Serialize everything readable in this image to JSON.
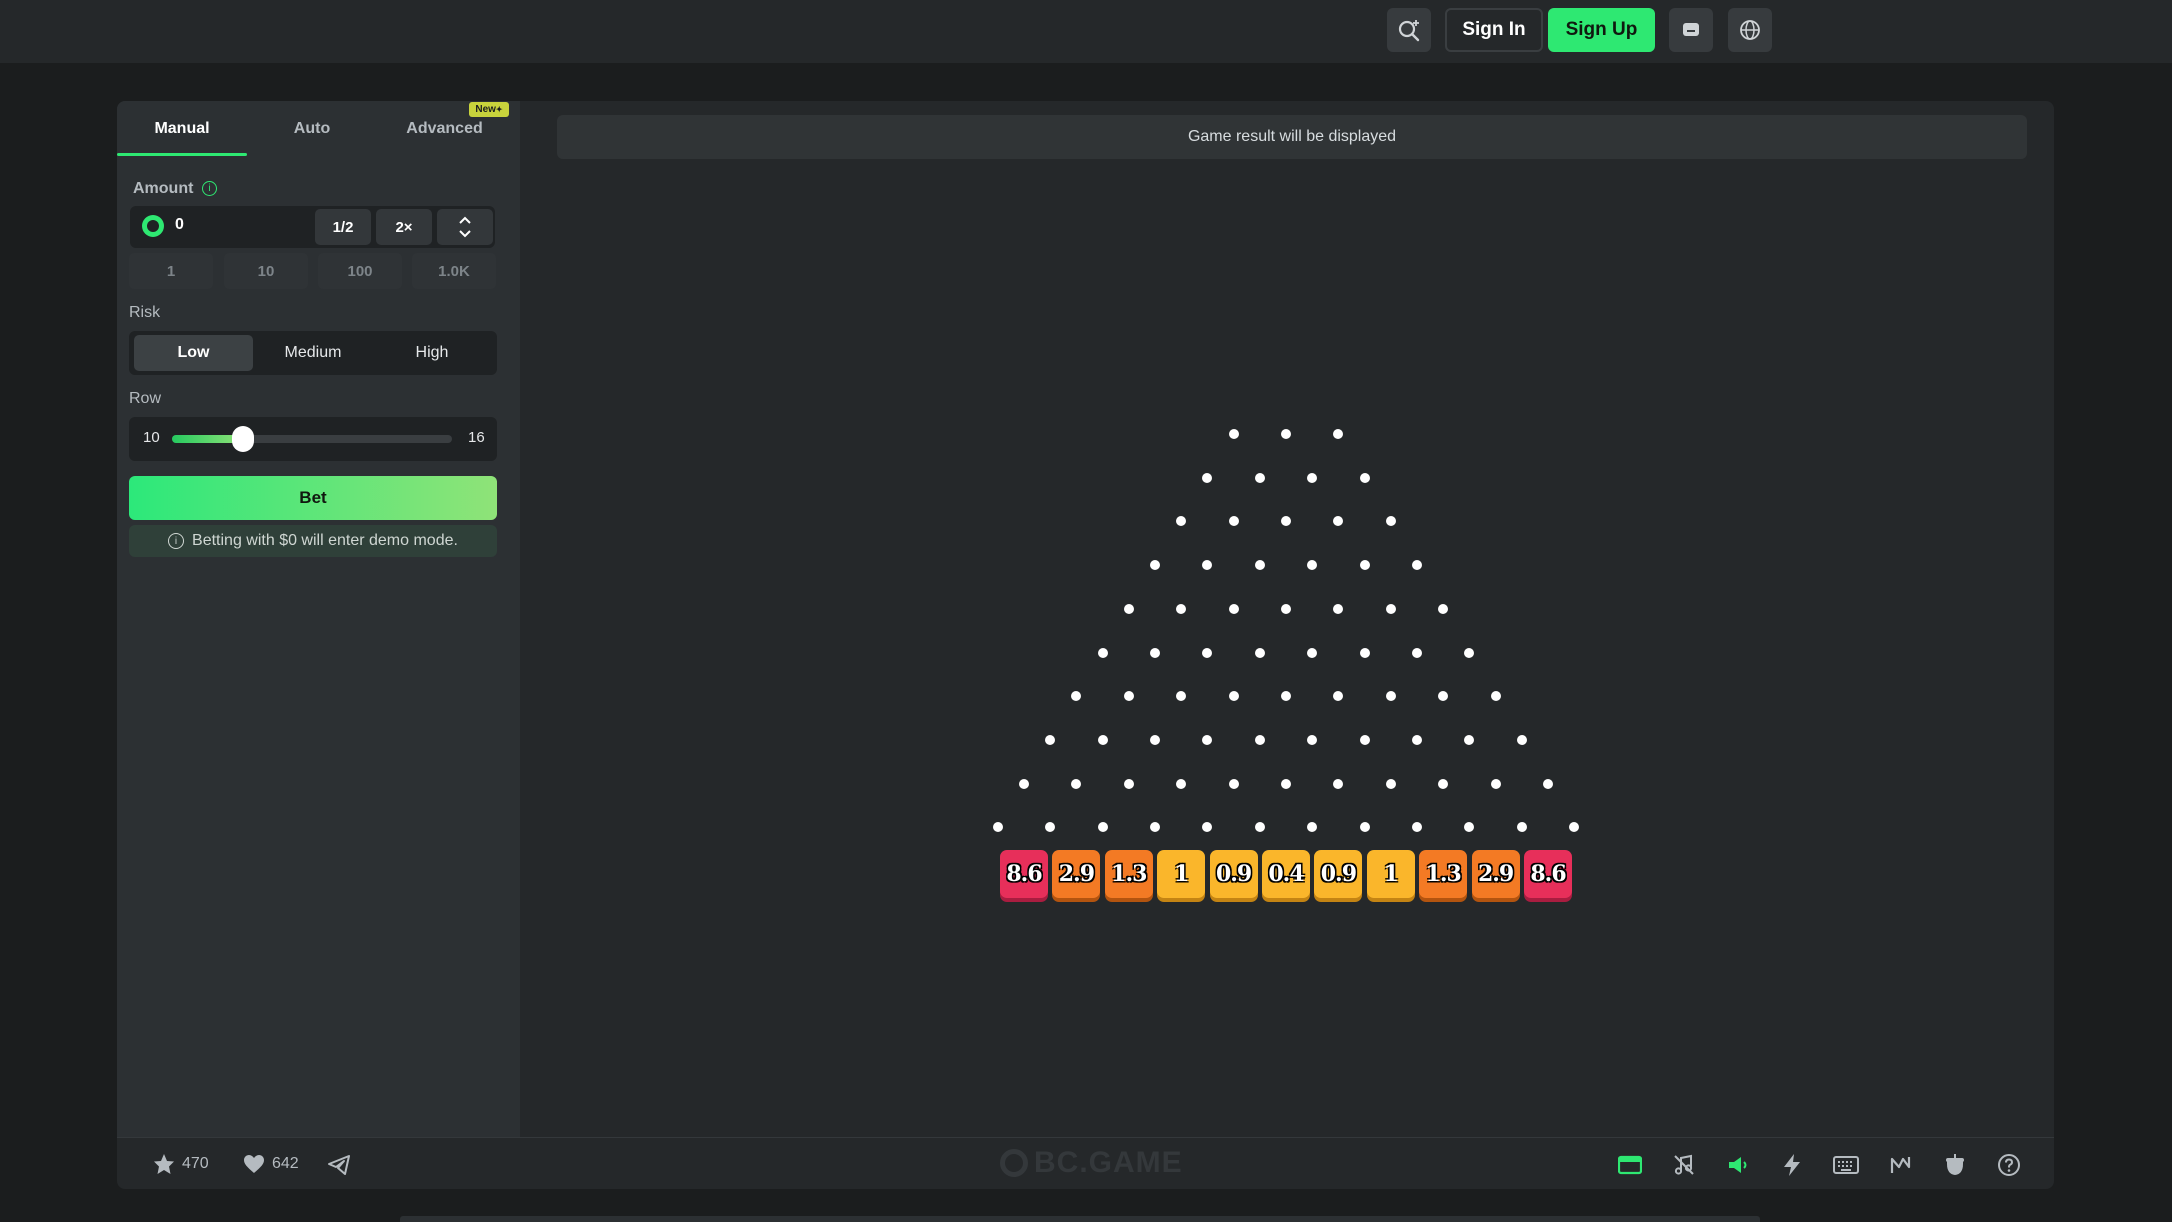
{
  "header": {
    "sign_in": "Sign In",
    "sign_up": "Sign Up"
  },
  "tabs": {
    "manual": "Manual",
    "auto": "Auto",
    "advanced": "Advanced",
    "new_badge": "New"
  },
  "amount": {
    "label": "Amount",
    "value": "0",
    "half": "1/2",
    "double": "2×",
    "chips": [
      "1",
      "10",
      "100",
      "1.0K"
    ]
  },
  "risk": {
    "label": "Risk",
    "options": [
      "Low",
      "Medium",
      "High"
    ],
    "selected": "Low"
  },
  "row": {
    "label": "Row",
    "min": "10",
    "max": "16",
    "value": 10
  },
  "bet": {
    "label": "Bet",
    "demo_note": "Betting with $0 will enter demo mode."
  },
  "result": {
    "text": "Game result will be displayed"
  },
  "multipliers": [
    {
      "label": "8.6",
      "color": "#e72f5a"
    },
    {
      "label": "2.9",
      "color": "#f37a24"
    },
    {
      "label": "1.3",
      "color": "#f37a24"
    },
    {
      "label": "1",
      "color": "#fab62b"
    },
    {
      "label": "0.9",
      "color": "#fab62b"
    },
    {
      "label": "0.4",
      "color": "#fab62b"
    },
    {
      "label": "0.9",
      "color": "#fab62b"
    },
    {
      "label": "1",
      "color": "#fab62b"
    },
    {
      "label": "1.3",
      "color": "#f37a24"
    },
    {
      "label": "2.9",
      "color": "#f37a24"
    },
    {
      "label": "8.6",
      "color": "#e72f5a"
    }
  ],
  "footer": {
    "stars": "470",
    "likes": "642",
    "watermark": "BC.GAME"
  },
  "colors": {
    "accent": "#2ee872",
    "panel": "#25282a",
    "sidebar": "#2c3033"
  }
}
